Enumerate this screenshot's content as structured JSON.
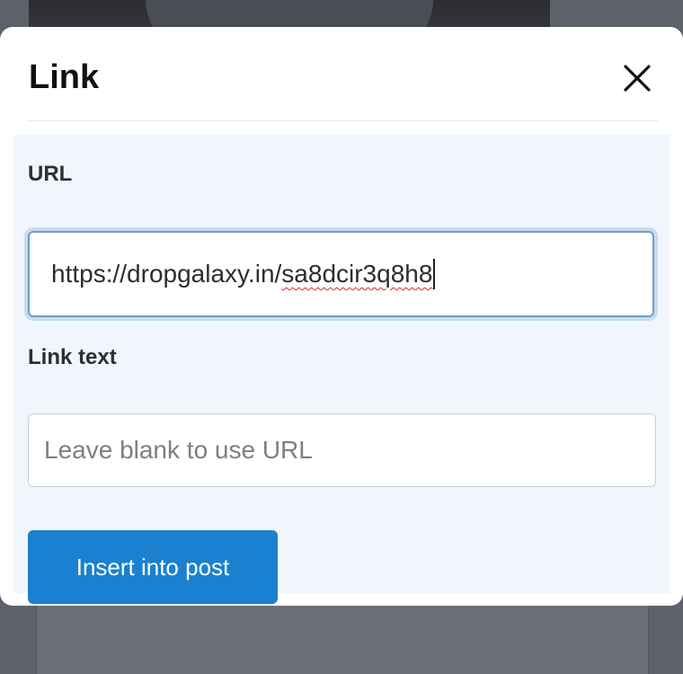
{
  "modal": {
    "title": "Link",
    "close_icon": "close-icon"
  },
  "url_field": {
    "label": "URL",
    "value_prefix": "https://dropgalaxy.in/",
    "value_misspelled": "sa8dcir3q8h8",
    "value": "https://dropgalaxy.in/sa8dcir3q8h8"
  },
  "link_text_field": {
    "label": "Link text",
    "placeholder": "Leave blank to use URL",
    "value": ""
  },
  "actions": {
    "insert_label": "Insert into post"
  },
  "colors": {
    "primary_button": "#1a80cf",
    "body_background": "#f0f6fb",
    "focus_ring": "#c7dcef",
    "spellcheck_underline": "#d7282f"
  }
}
